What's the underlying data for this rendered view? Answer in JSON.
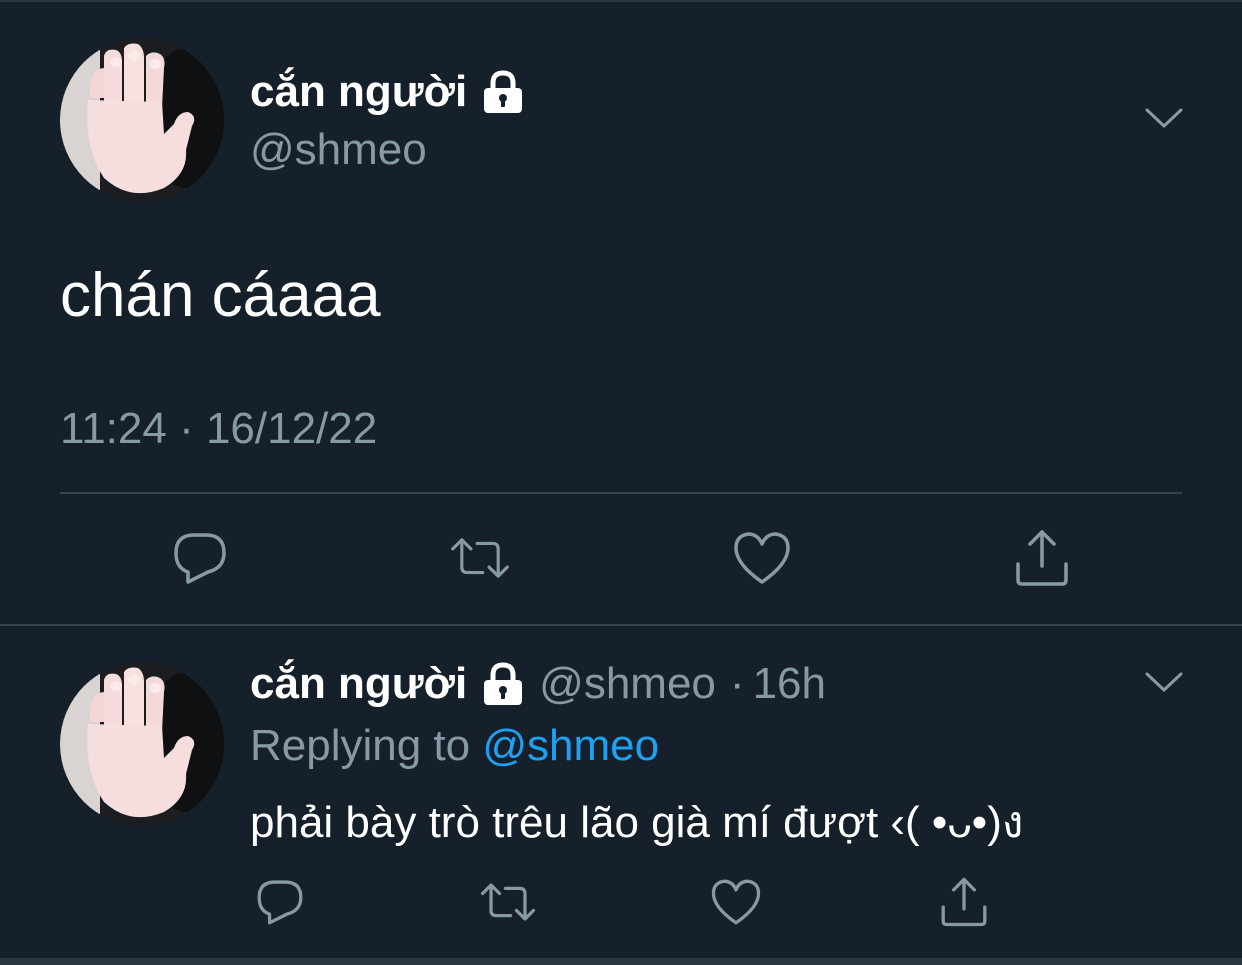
{
  "theme": {
    "background": "#15202b",
    "text_primary": "#ffffff",
    "text_secondary": "#8899a6",
    "accent": "#1da1f2",
    "divider": "#38444d"
  },
  "main_tweet": {
    "display_name": "cắn người",
    "protected_icon": "lock-icon",
    "handle": "@shmeo",
    "text": "chán cáaaa",
    "timestamp": "11:24 · 16/12/22",
    "menu_icon": "chevron-down-icon",
    "actions": [
      {
        "icon": "reply-icon"
      },
      {
        "icon": "retweet-icon"
      },
      {
        "icon": "like-icon"
      },
      {
        "icon": "share-icon"
      }
    ]
  },
  "reply_tweet": {
    "display_name": "cắn người",
    "protected_icon": "lock-icon",
    "handle": "@shmeo",
    "separator": "·",
    "age": "16h",
    "replying_prefix": "Replying to ",
    "replying_to": "@shmeo",
    "text": "phải bày trò trêu lão già mí đượt ‹( •ᴗ•)ง",
    "menu_icon": "chevron-down-icon",
    "actions": [
      {
        "icon": "reply-icon"
      },
      {
        "icon": "retweet-icon"
      },
      {
        "icon": "like-icon"
      },
      {
        "icon": "share-icon"
      }
    ]
  }
}
